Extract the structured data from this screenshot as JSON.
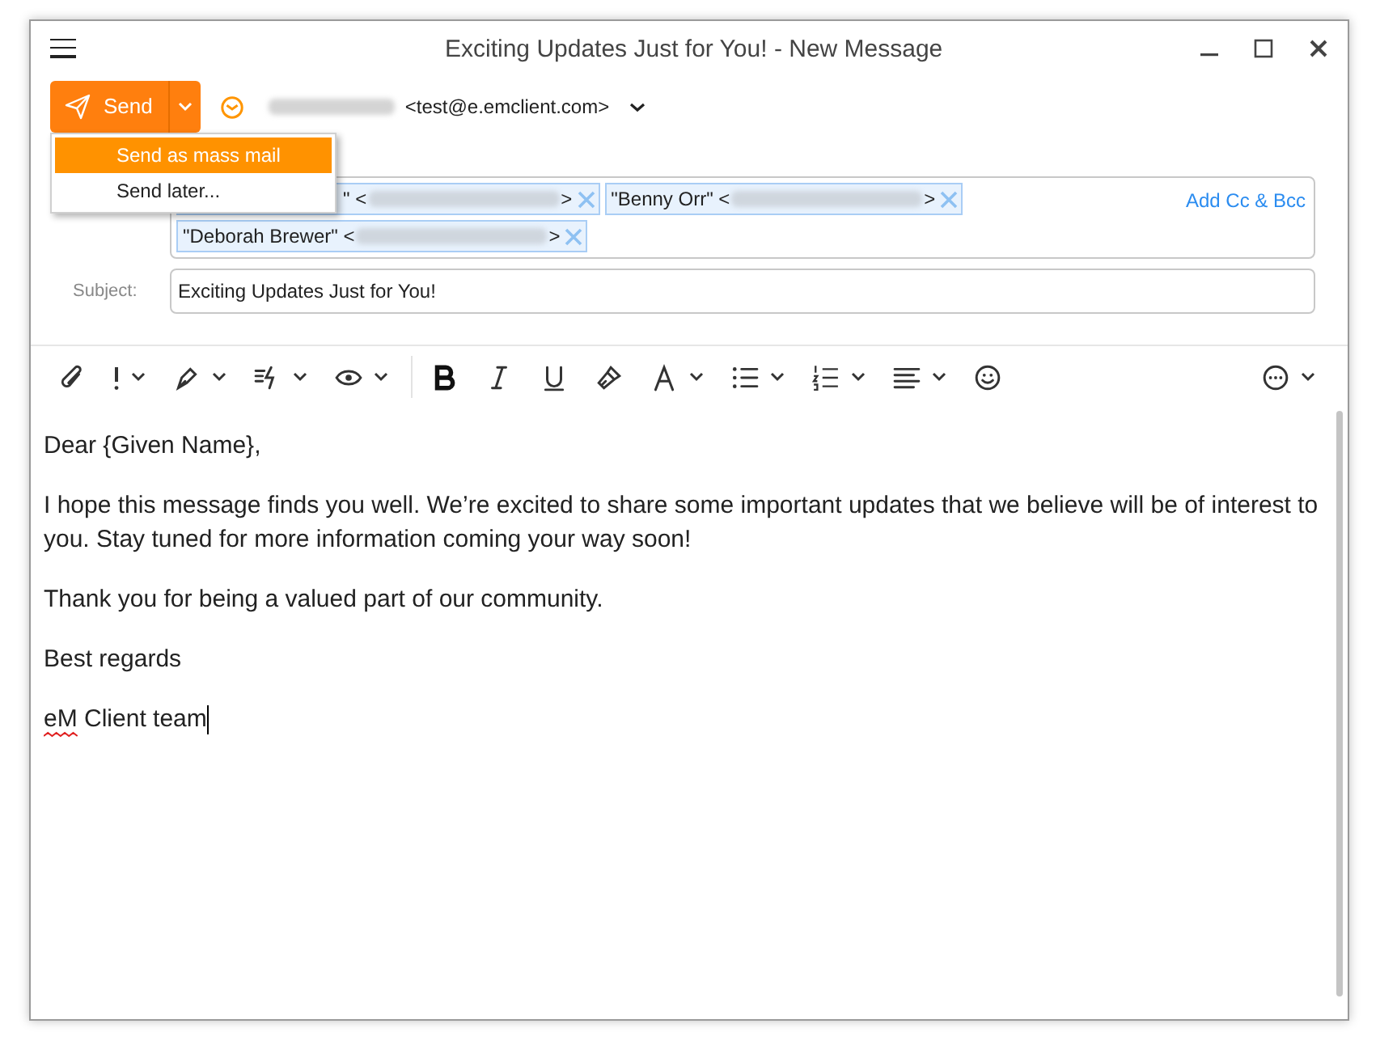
{
  "window": {
    "title": "Exciting Updates Just for You! - New Message"
  },
  "send_button": {
    "label": "Send"
  },
  "send_menu": [
    {
      "label": "Send as mass mail",
      "selected": true
    },
    {
      "label": "Send later...",
      "selected": false
    }
  ],
  "from": {
    "address": "<test@e.emclient.com>"
  },
  "recipients": [
    {
      "prefix": "\" <",
      "suffix": ">",
      "partly_hidden": true
    },
    {
      "prefix": "\"Benny Orr\" <",
      "suffix": ">",
      "partly_hidden": false
    },
    {
      "prefix": "\"Deborah Brewer\" <",
      "suffix": ">",
      "partly_hidden": false
    }
  ],
  "add_cc_bcc": "Add Cc & Bcc",
  "subject": {
    "label": "Subject:",
    "value": "Exciting Updates Just for You!"
  },
  "toolbar": [
    {
      "kind": "attach",
      "dropdown": false
    },
    {
      "kind": "priority",
      "dropdown": true
    },
    {
      "kind": "signature",
      "dropdown": true
    },
    {
      "kind": "templates",
      "dropdown": true
    },
    {
      "kind": "receipt",
      "dropdown": true
    },
    {
      "kind": "separator"
    },
    {
      "kind": "bold",
      "dropdown": false
    },
    {
      "kind": "italic",
      "dropdown": false
    },
    {
      "kind": "underline",
      "dropdown": false
    },
    {
      "kind": "format-painter",
      "dropdown": false
    },
    {
      "kind": "font",
      "dropdown": true
    },
    {
      "kind": "bullets",
      "dropdown": true
    },
    {
      "kind": "numbering",
      "dropdown": true
    },
    {
      "kind": "align",
      "dropdown": true
    },
    {
      "kind": "emoji",
      "dropdown": false
    },
    {
      "kind": "spacer"
    },
    {
      "kind": "more",
      "dropdown": true
    }
  ],
  "body": [
    {
      "segments": [
        {
          "text": "Dear {Given Name},",
          "misspelled": false
        }
      ],
      "cursor": false
    },
    {
      "segments": [
        {
          "text": "I hope this message finds you well. We’re excited to share some important updates that we believe will be of interest to you. Stay tuned for more information coming your way soon!",
          "misspelled": false
        }
      ],
      "cursor": false
    },
    {
      "segments": [
        {
          "text": "Thank you for being a valued part of our community.",
          "misspelled": false
        }
      ],
      "cursor": false
    },
    {
      "segments": [
        {
          "text": "Best regards",
          "misspelled": false
        }
      ],
      "cursor": false
    },
    {
      "segments": [
        {
          "text": "eM",
          "misspelled": true
        },
        {
          "text": " Client team",
          "misspelled": false
        }
      ],
      "cursor": true
    }
  ]
}
